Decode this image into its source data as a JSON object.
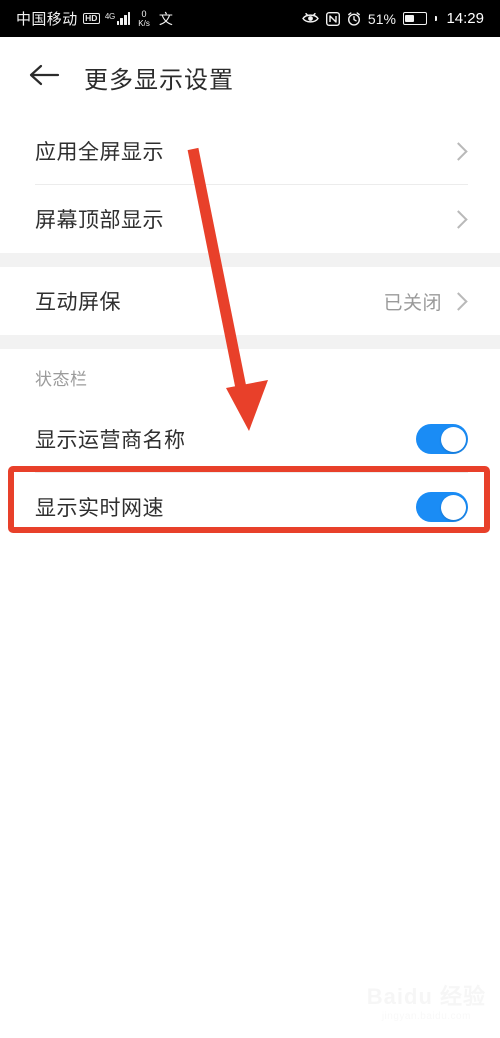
{
  "statusbar": {
    "carrier": "中国移动",
    "hd_badge": "HD",
    "network_type": "4G",
    "netspeed_value": "0",
    "netspeed_unit": "K/s",
    "ime_glyph": "文",
    "eye_comfort_icon": "eye-comfort-icon",
    "nfc_icon": "nfc-icon",
    "alarm_icon": "alarm-clock-icon",
    "battery_percent": "51%",
    "battery_level": 51,
    "clock": "14:29"
  },
  "appbar": {
    "back_icon": "back-arrow-icon",
    "title": "更多显示设置"
  },
  "groups": [
    {
      "rows": [
        {
          "label": "应用全屏显示",
          "type": "chevron",
          "value": ""
        },
        {
          "label": "屏幕顶部显示",
          "type": "chevron",
          "value": ""
        }
      ]
    },
    {
      "rows": [
        {
          "label": "互动屏保",
          "type": "chevron",
          "value": "已关闭"
        }
      ]
    },
    {
      "header": "状态栏",
      "rows": [
        {
          "label": "显示运营商名称",
          "type": "toggle",
          "on": true
        },
        {
          "label": "显示实时网速",
          "type": "toggle",
          "on": true
        }
      ]
    }
  ],
  "annotations": {
    "arrow_color": "#e8402a",
    "box_color": "#e8402a",
    "arrow_target": "显示实时网速"
  },
  "watermark": {
    "main": "Baidu 经验",
    "sub": "jingyan.baidu.com"
  }
}
